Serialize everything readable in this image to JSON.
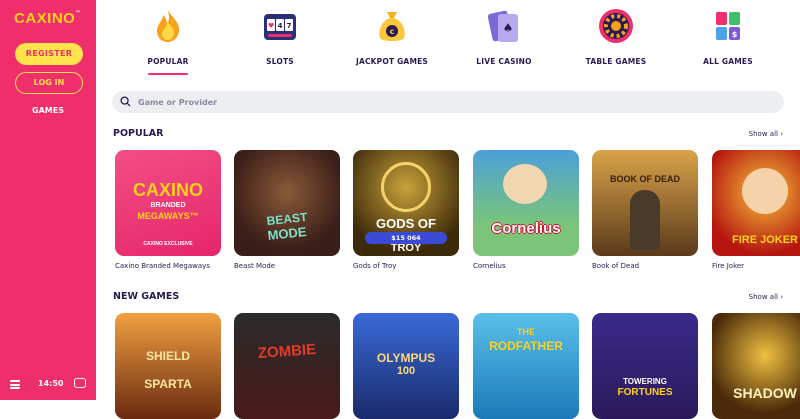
{
  "sidebar": {
    "logo": "CAXINO",
    "logo_mark": "™",
    "register_label": "REGISTER",
    "login_label": "LOG IN",
    "games_label": "GAMES",
    "time": "14:50",
    "menu_icon": "hamburger-icon",
    "chat_icon": "chat-icon"
  },
  "categories": [
    {
      "label": "POPULAR",
      "icon": "flame-icon",
      "active": true
    },
    {
      "label": "SLOTS",
      "icon": "slot-machine-icon"
    },
    {
      "label": "JACKPOT GAMES",
      "icon": "money-bag-icon"
    },
    {
      "label": "LIVE CASINO",
      "icon": "cards-icon"
    },
    {
      "label": "TABLE GAMES",
      "icon": "roulette-wheel-icon"
    },
    {
      "label": "ALL GAMES",
      "icon": "grid-icon"
    }
  ],
  "search": {
    "placeholder": "Game or Provider",
    "icon": "search-icon"
  },
  "popular": {
    "title": "POPULAR",
    "show_all": "Show all",
    "games": [
      {
        "name": "Caxino Branded Megaways",
        "art_title": "CAXINO",
        "art_sub": "BRANDED",
        "art_sub2": "MEGAWAYS™",
        "badge": "CAXINO EXCLUSIVE"
      },
      {
        "name": "Beast Mode",
        "art_title": "BEAST",
        "art_sub": "MODE"
      },
      {
        "name": "Gods of Troy",
        "art_title": "GODS OF",
        "art_sub": "TROY",
        "jackpot": "$15 064"
      },
      {
        "name": "Cornelius",
        "art_title": "Cornelius"
      },
      {
        "name": "Book of Dead",
        "art_title": "BOOK OF DEAD"
      },
      {
        "name": "Fire Joker",
        "art_title": "FIRE JOKER"
      }
    ]
  },
  "new_games": {
    "title": "NEW GAMES",
    "show_all": "Show all",
    "games": [
      {
        "art_title": "SHIELD",
        "art_sub": "SPARTA"
      },
      {
        "art_title": "ZOMBIE"
      },
      {
        "art_title": "OLYMPUS",
        "art_sub": "100"
      },
      {
        "art_title": "THE",
        "art_sub": "RODFATHER"
      },
      {
        "art_title": "TOWERING",
        "art_sub": "FORTUNES"
      },
      {
        "art_title": "SHADOW"
      }
    ]
  },
  "colors": {
    "brand": "#ef2e6c",
    "accent": "#ffe34a",
    "text": "#2a1a52"
  }
}
